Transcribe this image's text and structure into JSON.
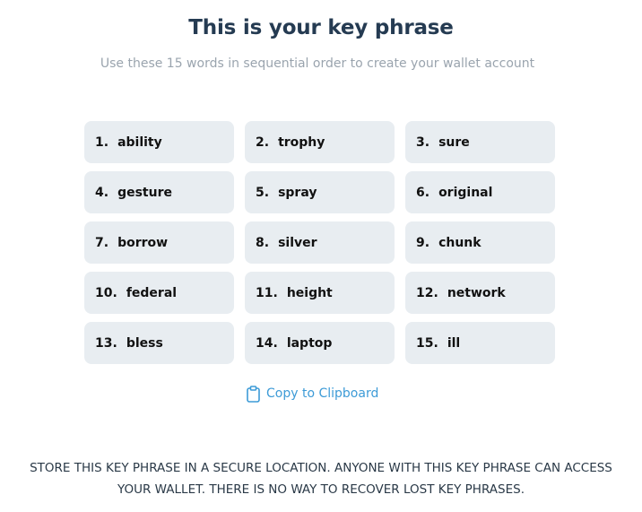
{
  "header": {
    "title": "This is your key phrase",
    "subtitle": "Use these 15 words in sequential order to create your wallet account"
  },
  "key_phrase": {
    "words": [
      {
        "number": "1.",
        "word": "ability"
      },
      {
        "number": "2.",
        "word": "trophy"
      },
      {
        "number": "3.",
        "word": "sure"
      },
      {
        "number": "4.",
        "word": "gesture"
      },
      {
        "number": "5.",
        "word": "spray"
      },
      {
        "number": "6.",
        "word": "original"
      },
      {
        "number": "7.",
        "word": "borrow"
      },
      {
        "number": "8.",
        "word": "silver"
      },
      {
        "number": "9.",
        "word": "chunk"
      },
      {
        "number": "10.",
        "word": "federal"
      },
      {
        "number": "11.",
        "word": "height"
      },
      {
        "number": "12.",
        "word": "network"
      },
      {
        "number": "13.",
        "word": "bless"
      },
      {
        "number": "14.",
        "word": "laptop"
      },
      {
        "number": "15.",
        "word": "ill"
      }
    ]
  },
  "copy": {
    "label": "Copy to Clipboard",
    "icon": "clipboard-icon"
  },
  "warning": {
    "text": "STORE THIS KEY PHRASE IN A SECURE LOCATION. ANYONE WITH THIS KEY PHRASE CAN ACCESS YOUR WALLET. THERE IS NO WAY TO RECOVER LOST KEY PHRASES."
  },
  "colors": {
    "title": "#253b52",
    "subtitle": "#9aa4ae",
    "cell_background": "#e8edf1",
    "link": "#3d9bd7"
  }
}
